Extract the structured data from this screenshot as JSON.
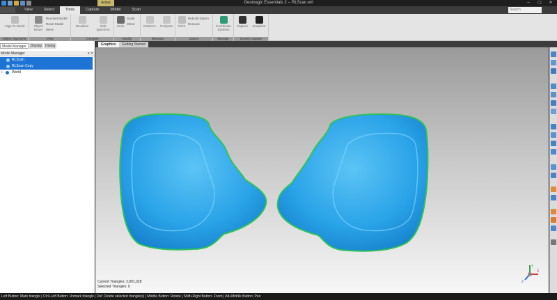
{
  "window": {
    "title": "Geomagic Essentials 2 -- RLScan.wrl",
    "context_tab": "Active",
    "controls": [
      "–",
      "▢",
      "✕"
    ]
  },
  "menu": {
    "tabs": [
      "View",
      "Select",
      "Tools",
      "Capture",
      "Model",
      "Scan"
    ],
    "active": "Tools",
    "search_placeholder": "Search"
  },
  "ribbon": {
    "groups": [
      {
        "label": "Object Alignment",
        "buttons": [
          "Align To World"
        ]
      },
      {
        "label": "View",
        "buttons": [
          "Object Mover"
        ],
        "small": [
          "Reorient Model",
          "Reset Model",
          "Move"
        ]
      },
      {
        "label": "Compare",
        "buttons": [
          "Deviation",
          "Edit Spectrum"
        ]
      },
      {
        "label": "Modify",
        "buttons": [
          "Undo"
        ],
        "small": [
          "Scale",
          "Mirror"
        ]
      },
      {
        "label": "Measure",
        "buttons": [
          "Distance",
          "Compute"
        ]
      },
      {
        "label": "Datum",
        "buttons": [
          "Point"
        ],
        "small": [
          "Rebuild Datum",
          "Remove"
        ]
      },
      {
        "label": "Manage",
        "buttons": [
          "Coordinate Systems"
        ]
      },
      {
        "label": "Screen Capture",
        "buttons": [
          "Capture",
          "Snapshot"
        ]
      }
    ]
  },
  "left_panel": {
    "tabs": [
      "Model Manager",
      "Display",
      "Dialog"
    ],
    "active_tab": "Model Manager",
    "header": "Model Manager",
    "pins": "▾ ✕",
    "items": [
      {
        "label": "RLScan",
        "selected": true
      },
      {
        "label": "RLScan Copy",
        "selected": true
      },
      {
        "label": "World",
        "selected": false
      }
    ]
  },
  "graphics": {
    "tabs": [
      "Graphics",
      "Getting Started"
    ],
    "active_tab": "Graphics",
    "stats": {
      "current_triangles": "Current Triangles: 2,891,328",
      "selected_triangles": "Selected Triangles: 0"
    },
    "triad": {
      "x": "X",
      "y": "Y",
      "z": "Z"
    },
    "mesh_color": "#27a4ea",
    "edge_color": "#2fc25a"
  },
  "status_bar": "Left Button: Mark triangle | Ctrl+Left Button: Unmark triangle | Del: Delete selected triangle(s) | Middle Button: Rotate | Shift+Right Button: Zoom | Alt+Middle Button: Pan"
}
